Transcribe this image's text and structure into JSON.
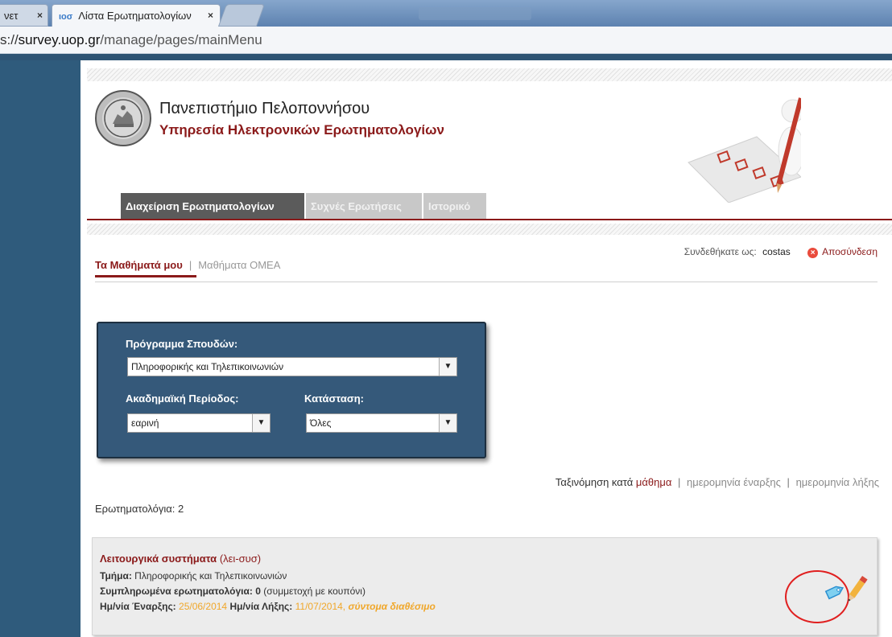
{
  "browser": {
    "prev_tab_label": "νετ",
    "active_tab_label": "Λίστα Ερωτηματολογίων",
    "favicon_text": "ιοσ",
    "close_symbol": "×",
    "url_prefix": "s://",
    "url_host": "survey.uop.gr",
    "url_path": "/manage/pages/mainMenu"
  },
  "header": {
    "university": "Πανεπιστήμιο Πελοποννήσου",
    "service": "Υπηρεσία Ηλεκτρονικών Ερωτηματολογίων"
  },
  "main_tabs": [
    {
      "label": "Διαχείριση Ερωτηματολογίων",
      "active": true
    },
    {
      "label": "Συχνές Ερωτήσεις",
      "active": false
    },
    {
      "label": "Ιστορικό",
      "active": false
    }
  ],
  "session": {
    "logged_in_label": "Συνδεθήκατε ως:",
    "username": "costas",
    "logout_label": "Αποσύνδεση",
    "logout_icon_symbol": "×"
  },
  "subnav": {
    "my_courses": "Τα Μαθήματά μου",
    "separator": "|",
    "omea_courses": "Μαθήματα ΟΜΕΑ"
  },
  "filters": {
    "program_label": "Πρόγραμμα Σπουδών:",
    "program_value": "Πληροφορικής και Τηλεπικοινωνιών",
    "period_label": "Ακαδημαϊκή Περίοδος:",
    "period_value": "εαρινή",
    "status_label": "Κατάσταση:",
    "status_value": "Όλες",
    "arrow_symbol": "▼"
  },
  "sort": {
    "prefix": "Ταξινόμηση κατά",
    "by_course": "μάθημα",
    "sep": "|",
    "by_start": "ημερομηνία έναρξης",
    "by_end": "ημερομηνία λήξης"
  },
  "survey_count": "Ερωτηματολόγια: 2",
  "survey": {
    "course_name": "Λειτουργικά συστήματα",
    "course_code": "(λει-συσ)",
    "dept_label": "Τμήμα:",
    "dept_value": "Πληροφορικής και Τηλεπικοινωνιών",
    "completed_label": "Συμπληρωμένα ερωτηματολόγια:",
    "completed_value": "0",
    "completed_note": "(συμμετοχή με κουπόνι)",
    "start_label": "Ημ/νία Έναρξης:",
    "start_date": "25/06/2014",
    "end_label": "Ημ/νία Λήξης:",
    "end_date": "11/07/2014,",
    "availability": "σύντομα διαθέσιμο"
  },
  "icons": {
    "tag": "tag-icon",
    "pencil": "edit-pencil-icon"
  },
  "colors": {
    "brand_red": "#8b1a1a",
    "sidebar_blue": "#2f5b7c",
    "filter_blue": "#35597a",
    "date_orange": "#f0a72a",
    "highlight": "#e01f1f"
  }
}
